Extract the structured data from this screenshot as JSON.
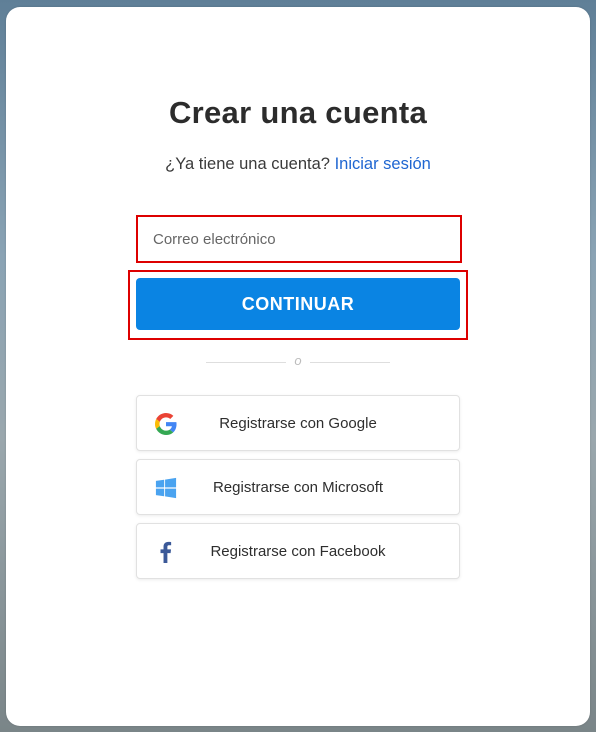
{
  "page": {
    "title": "Crear una cuenta",
    "subtitle_text": "¿Ya tiene una cuenta?",
    "login_link": "Iniciar sesión"
  },
  "form": {
    "email_placeholder": "Correo electrónico",
    "email_value": "",
    "continue_label": "CONTINUAR"
  },
  "divider": {
    "text": "o"
  },
  "social": [
    {
      "label": "Registrarse con Google",
      "icon": "google-icon"
    },
    {
      "label": "Registrarse con Microsoft",
      "icon": "windows-icon"
    },
    {
      "label": "Registrarse con Facebook",
      "icon": "facebook-icon"
    }
  ],
  "colors": {
    "primary": "#0a84e3",
    "link": "#1f66d1",
    "highlight": "#dd0000",
    "facebook": "#3b5998",
    "microsoft": "#4aa3f0"
  }
}
